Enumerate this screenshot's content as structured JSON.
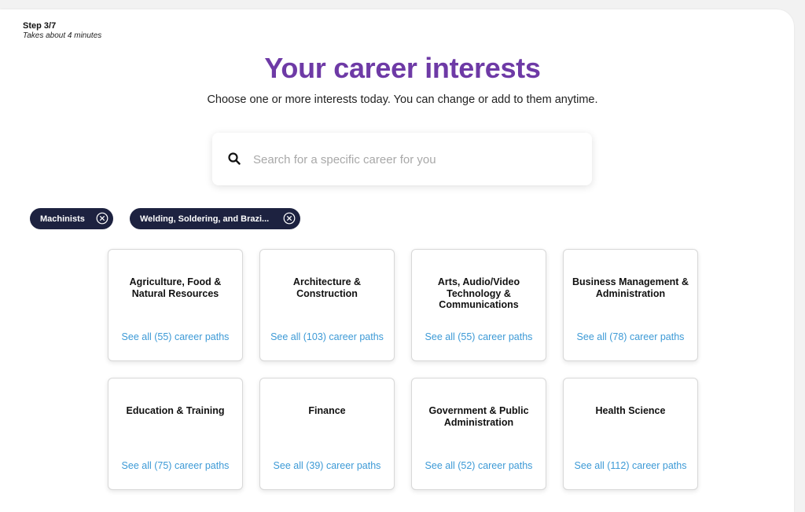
{
  "header": {
    "step": "Step 3/7",
    "duration": "Takes about 4 minutes",
    "title": "Your career interests",
    "subtitle": "Choose one or more interests today. You can change or add to them anytime."
  },
  "search": {
    "icon": "search-icon",
    "placeholder": "Search for a specific career for you",
    "value": ""
  },
  "selected_chips": [
    {
      "label": "Machinists",
      "icon": "close-circle-icon"
    },
    {
      "label": "Welding, Soldering, and Brazi...",
      "icon": "close-circle-icon"
    }
  ],
  "categories": [
    {
      "title": "Agriculture, Food & Natural Resources",
      "link": "See all (55) career paths"
    },
    {
      "title": "Architecture & Construction",
      "link": "See all (103) career paths"
    },
    {
      "title": "Arts, Audio/Video Technology & Communications",
      "link": "See all (55) career paths"
    },
    {
      "title": "Business Management & Administration",
      "link": "See all (78) career paths"
    },
    {
      "title": "Education & Training",
      "link": "See all (75) career paths"
    },
    {
      "title": "Finance",
      "link": "See all (39) career paths"
    },
    {
      "title": "Government & Public Administration",
      "link": "See all (52) career paths"
    },
    {
      "title": "Health Science",
      "link": "See all (112) career paths"
    }
  ],
  "colors": {
    "title": "#6e3aa6",
    "chip_bg": "#1d2240",
    "link": "#3d9ad6"
  }
}
